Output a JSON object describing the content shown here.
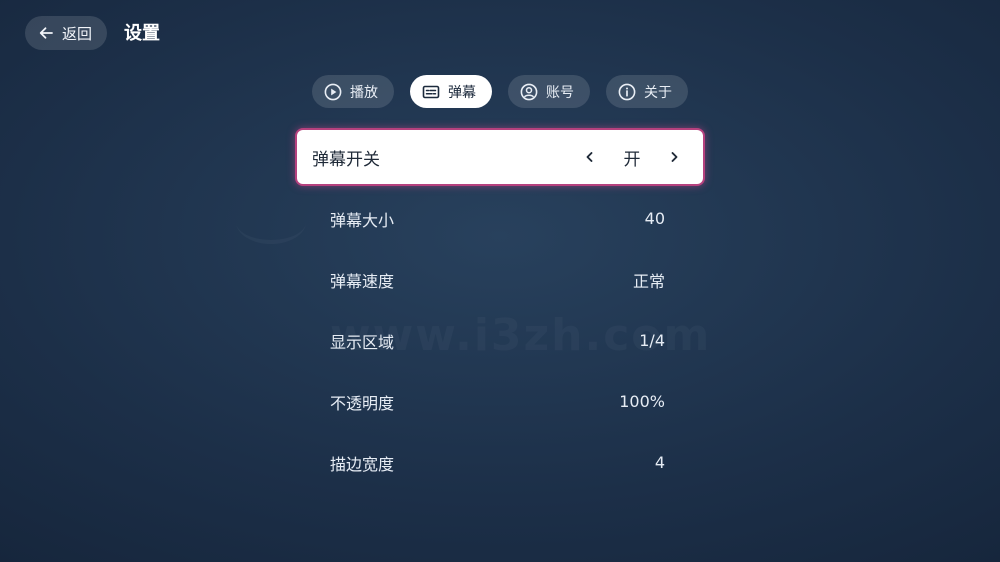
{
  "header": {
    "back_label": "返回",
    "title": "设置"
  },
  "tabs": [
    {
      "label": "播放",
      "icon": "play-circle-icon",
      "active": false
    },
    {
      "label": "弹幕",
      "icon": "subtitles-icon",
      "active": true
    },
    {
      "label": "账号",
      "icon": "account-circle-icon",
      "active": false
    },
    {
      "label": "关于",
      "icon": "info-icon",
      "active": false
    }
  ],
  "settings": [
    {
      "label": "弹幕开关",
      "value": "开"
    },
    {
      "label": "弹幕大小",
      "value": "40"
    },
    {
      "label": "弹幕速度",
      "value": "正常"
    },
    {
      "label": "显示区域",
      "value": "1/4"
    },
    {
      "label": "不透明度",
      "value": "100%"
    },
    {
      "label": "描边宽度",
      "value": "4"
    }
  ],
  "watermark": "www.i3zh.com",
  "colors": {
    "focus_glow": "#b6417e",
    "background": "#1c2f48",
    "active_tab": "#ffffff"
  }
}
